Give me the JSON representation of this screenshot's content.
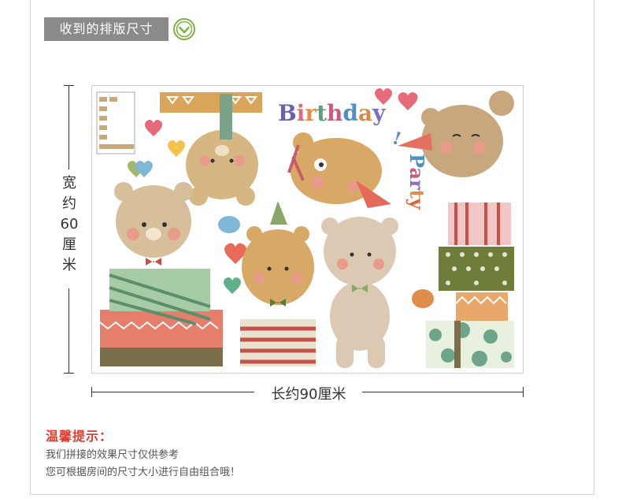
{
  "header": {
    "title": "收到的排版尺寸",
    "check_icon": "check-circle-icon",
    "accent_color": "#7cb342"
  },
  "dimensions": {
    "width_label": "宽约60厘米",
    "length_label": "长约90厘米"
  },
  "product": {
    "art_text": "Birthday Party"
  },
  "tips": {
    "title": "温馨提示：",
    "line1": "我们拼接的效果尺寸仅供参考",
    "line2": "您可根据房间的尺寸大小进行自由组合哦！",
    "title_color": "#e23a2c"
  }
}
